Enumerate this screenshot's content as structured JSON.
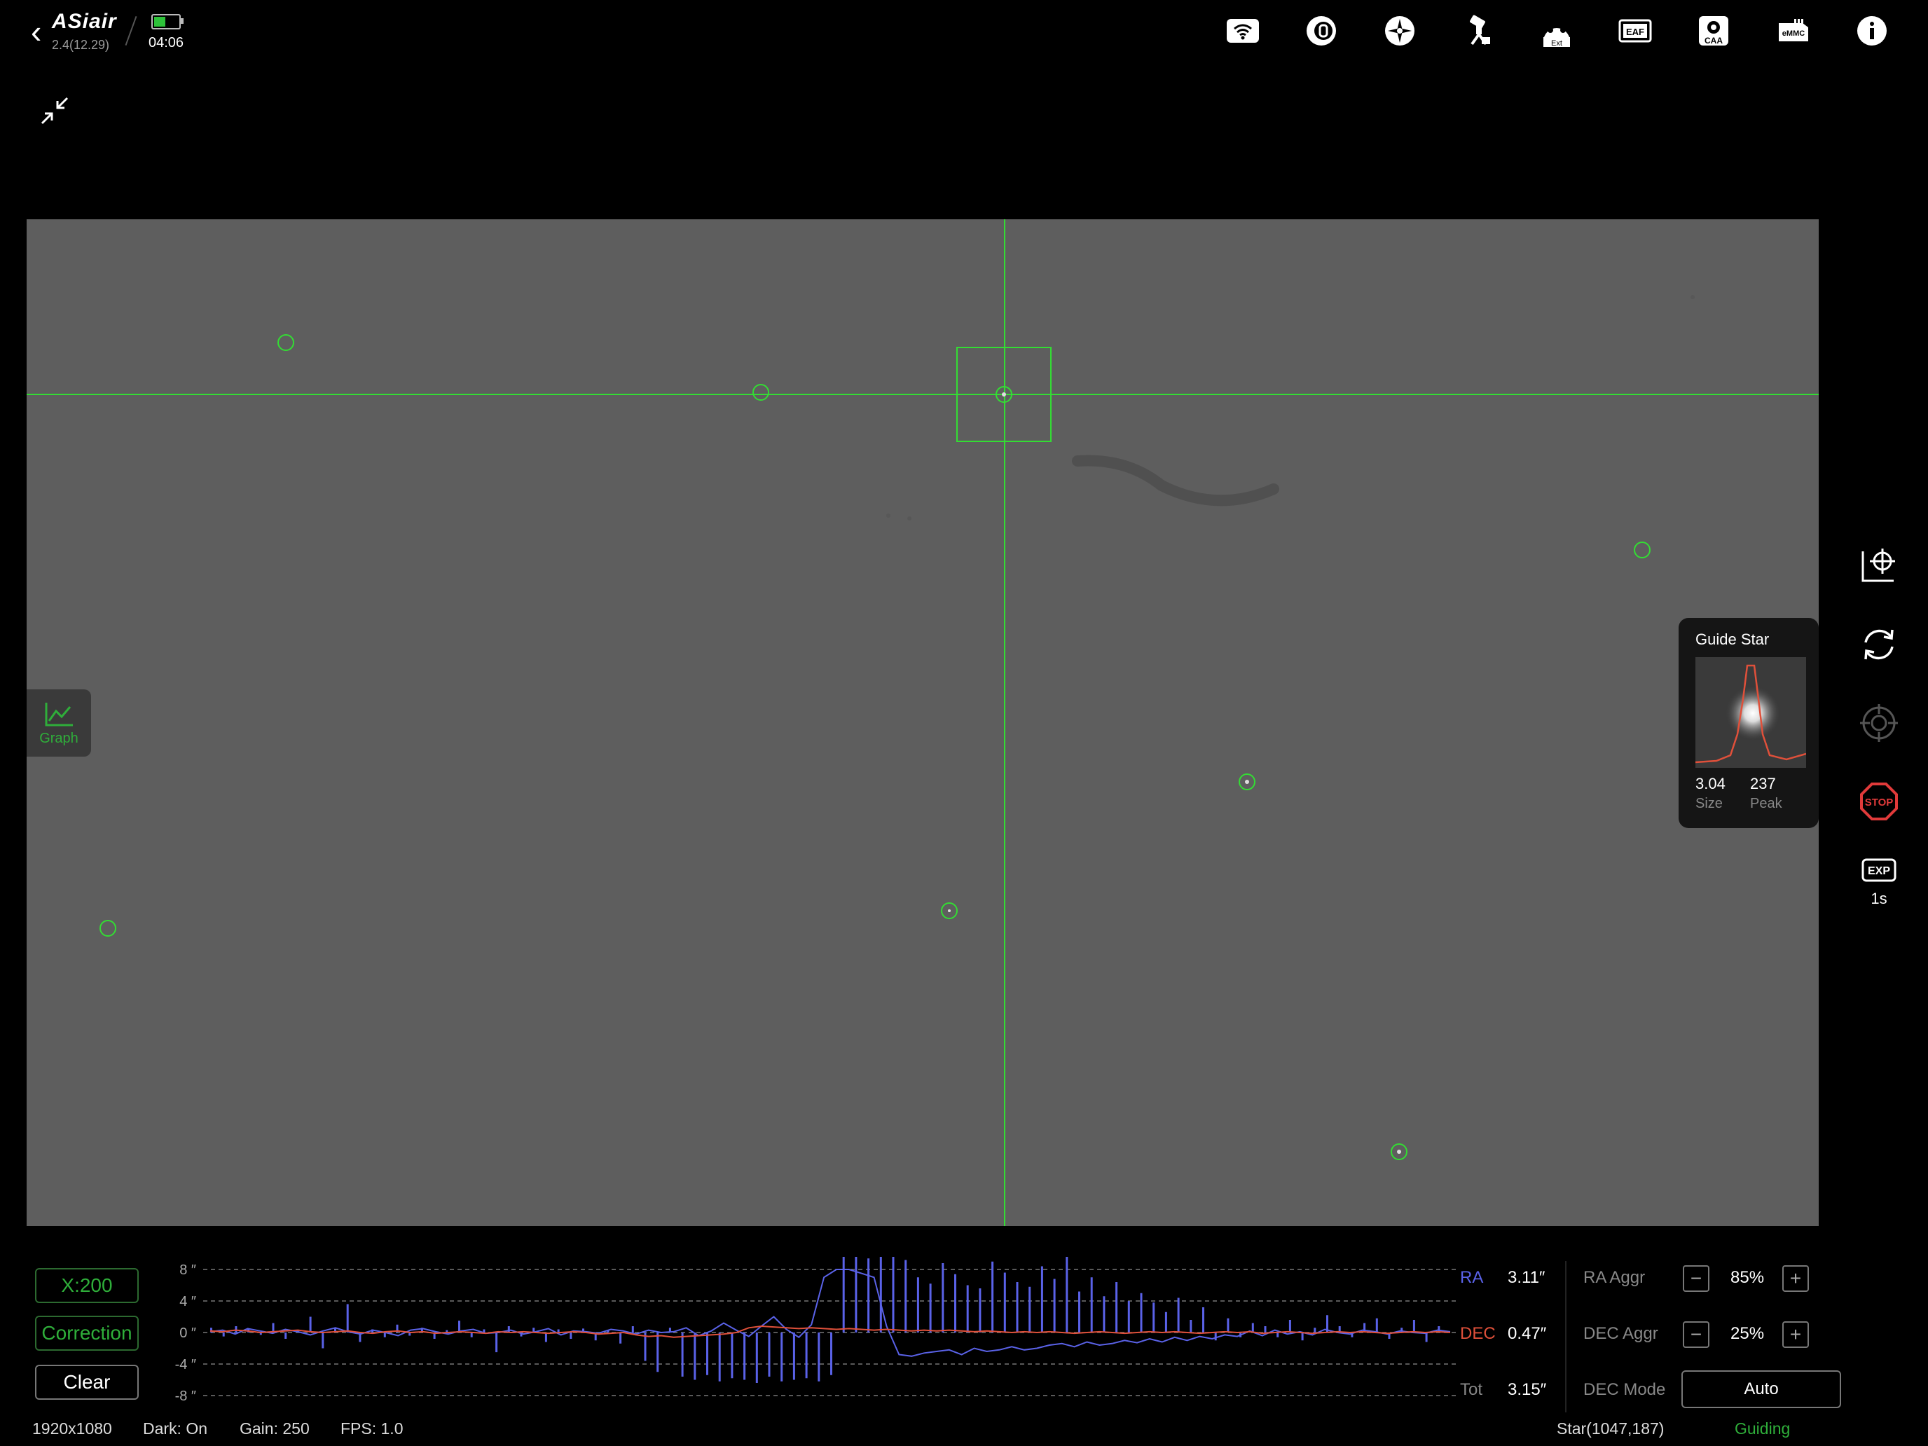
{
  "header": {
    "logo": "ASiair",
    "version": "2.4(12.29)",
    "time": "04:06",
    "battery_color": "#2ec23a",
    "icons": [
      "wifi-icon",
      "camera-icon",
      "guide-camera-icon",
      "mount-icon",
      "filter-wheel-ext-icon",
      "eaf-icon",
      "caa-icon",
      "emmc-icon",
      "info-icon"
    ],
    "icon_labels": {
      "ext": "Ext",
      "eaf": "EAF",
      "caa": "CAA",
      "emmc": "eMMC"
    }
  },
  "graph_tab": {
    "label": "Graph"
  },
  "guide_star": {
    "title": "Guide Star",
    "size_value": "3.04",
    "size_label": "Size",
    "peak_value": "237",
    "peak_label": "Peak"
  },
  "side": {
    "stop_label": "STOP",
    "exp_badge": "EXP",
    "exp_value": "1s"
  },
  "controls": {
    "scale": "X:200",
    "correction": "Correction",
    "clear": "Clear"
  },
  "chart_data": {
    "type": "line",
    "y_ticks": [
      "8 ″",
      "4 ″",
      "0 ″",
      "-4 ″",
      "-8 ″"
    ],
    "ylim": [
      -8,
      8
    ],
    "grid": true,
    "series": [
      {
        "name": "RA",
        "color": "#5a62e8"
      },
      {
        "name": "DEC",
        "color": "#e0503a"
      }
    ],
    "ra_line": [
      0.1,
      0.3,
      -0.2,
      0.5,
      0.2,
      -0.1,
      0.4,
      0.1,
      -0.3,
      0.2,
      0.6,
      0.1,
      -0.2,
      0.3,
      0.0,
      -0.4,
      0.3,
      0.5,
      0.1,
      -0.2,
      0.2,
      0.4,
      -0.1,
      0.0,
      0.3,
      -0.2,
      0.1,
      0.5,
      -0.3,
      0.2,
      0.1,
      -0.1,
      0.4,
      0.2,
      -0.2,
      0.3,
      0.0,
      0.1,
      0.6,
      -0.4,
      0.2,
      1.2,
      0.3,
      -0.5,
      0.8,
      2.0,
      0.4,
      -0.6,
      1.0,
      7.0,
      8.0,
      8.0,
      7.5,
      7.0,
      0.8,
      -2.8,
      -3.0,
      -2.6,
      -2.4,
      -2.2,
      -2.8,
      -2.0,
      -2.4,
      -2.2,
      -1.8,
      -2.2,
      -2.0,
      -1.6,
      -1.4,
      -1.8,
      -1.2,
      -1.6,
      -1.4,
      -1.0,
      -1.3,
      -0.8,
      -1.2,
      -0.6,
      -1.0,
      -0.5,
      -0.8,
      -0.3,
      -0.5,
      0.2,
      -0.4,
      0.3,
      -0.2,
      0.1,
      -0.3,
      0.4,
      0.0,
      -0.2,
      0.3,
      0.1,
      -0.2,
      0.2,
      0.0,
      -0.1,
      0.3,
      0.1
    ],
    "dec_line": [
      0.2,
      0.1,
      0.3,
      0.2,
      0.0,
      0.1,
      0.2,
      0.3,
      0.1,
      0.0,
      0.1,
      0.2,
      0.0,
      -0.1,
      0.1,
      0.2,
      0.0,
      0.1,
      -0.1,
      0.0,
      0.1,
      0.0,
      -0.1,
      0.1,
      0.0,
      0.1,
      0.0,
      -0.1,
      0.0,
      0.1,
      0.0,
      -0.2,
      -0.1,
      0.0,
      -0.3,
      -0.5,
      -0.4,
      -0.6,
      -0.5,
      -0.4,
      -0.3,
      -0.2,
      0.0,
      0.6,
      0.8,
      0.7,
      0.6,
      0.5,
      0.6,
      0.5,
      0.4,
      0.5,
      0.4,
      0.3,
      0.4,
      0.3,
      0.2,
      0.3,
      0.2,
      0.3,
      0.2,
      0.1,
      0.2,
      0.1,
      0.0,
      0.1,
      0.0,
      0.1,
      0.0,
      -0.1,
      0.0,
      0.1,
      0.0,
      -0.1,
      0.0,
      0.1,
      0.0,
      0.1,
      0.0,
      -0.1,
      0.0,
      0.1,
      0.0,
      0.1,
      -0.1,
      0.0,
      0.1,
      0.0,
      -0.1,
      0.0,
      0.1,
      0.0,
      0.1,
      0.0,
      -0.1,
      0.0,
      0.1,
      0.0,
      0.1,
      0.0
    ],
    "ra_bars": [
      0.6,
      -0.5,
      0.8,
      0.4,
      -0.3,
      1.2,
      -0.8,
      0.3,
      2.0,
      -2.0,
      0.5,
      3.6,
      -1.2,
      0.4,
      -0.6,
      1.0,
      -0.4,
      0.6,
      -0.8,
      0.3,
      1.5,
      -0.6,
      0.4,
      -2.5,
      0.8,
      -0.5,
      0.6,
      -1.2,
      0.4,
      -0.8,
      0.5,
      -1.0,
      0.3,
      -1.4,
      0.8,
      -3.6,
      -5.0,
      0.6,
      -5.6,
      -6.0,
      -5.4,
      -6.2,
      -5.8,
      -6.0,
      -6.4,
      -5.6,
      -6.2,
      -6.0,
      -5.8,
      -6.2,
      -5.4,
      9.6,
      9.8,
      9.4,
      9.6,
      9.8,
      9.2,
      7.0,
      6.2,
      8.8,
      7.4,
      6.0,
      5.6,
      9.0,
      7.6,
      6.4,
      5.8,
      8.4,
      6.8,
      9.6,
      5.2,
      7.0,
      4.6,
      6.4,
      4.0,
      5.0,
      3.8,
      2.6,
      4.4,
      1.6,
      3.2,
      -1.0,
      1.8,
      -0.6,
      1.2,
      0.8,
      -0.6,
      1.6,
      -1.0,
      0.6,
      2.2,
      0.8,
      -0.6,
      1.2,
      1.8,
      -0.8,
      0.6,
      1.6,
      -1.2,
      0.8
    ],
    "ra_value_label": "RA",
    "ra_value": "3.11″",
    "dec_value_label": "DEC",
    "dec_value": "0.47″",
    "tot_value_label": "Tot",
    "tot_value": "3.15″"
  },
  "aggression": {
    "ra_label": "RA Aggr",
    "ra_value": "85%",
    "dec_label": "DEC Aggr",
    "dec_value": "25%",
    "mode_label": "DEC Mode",
    "mode_value": "Auto",
    "minus": "−",
    "plus": "+"
  },
  "status_bar": {
    "resolution": "1920x1080",
    "dark": "Dark: On",
    "gain": "Gain: 250",
    "fps": "FPS: 1.0",
    "star": "Star(1047,187)",
    "state": "Guiding",
    "state_color": "#2fae3a"
  },
  "colors": {
    "accent": "#2fae3a",
    "crosshair": "#33dd33",
    "ra": "#5a62e8",
    "dec": "#e0503a",
    "stop": "#e03a3a"
  }
}
